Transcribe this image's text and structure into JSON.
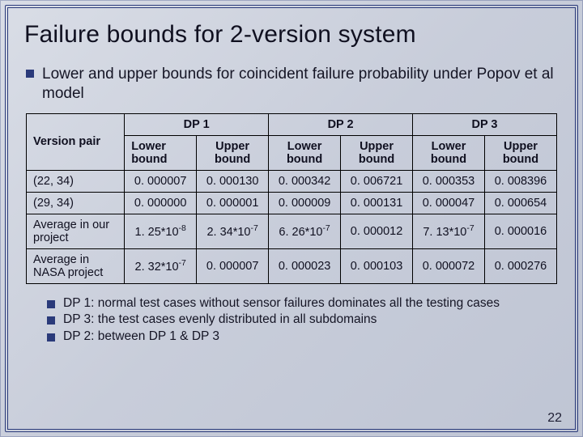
{
  "title": "Failure bounds for 2-version system",
  "lead": "Lower and upper bounds for coincident failure probability under Popov et al model",
  "table": {
    "corner": "Version pair",
    "dp_headers": [
      "DP 1",
      "DP 2",
      "DP 3"
    ],
    "sub_headers": [
      "Lower bound",
      "Upper bound"
    ],
    "rows": [
      {
        "label": "(22, 34)",
        "cells": [
          "0. 000007",
          "0. 000130",
          "0. 000342",
          "0. 006721",
          "0. 000353",
          "0. 008396"
        ]
      },
      {
        "label": "(29, 34)",
        "cells": [
          "0. 000000",
          "0. 000001",
          "0. 000009",
          "0. 000131",
          "0. 000047",
          "0. 000654"
        ]
      },
      {
        "label": "Average in our project",
        "cells": [
          "1. 25*10<sup>-8</sup>",
          "2. 34*10<sup>-7</sup>",
          "6. 26*10<sup>-7</sup>",
          "0. 000012",
          "7. 13*10<sup>-7</sup>",
          "0. 000016"
        ]
      },
      {
        "label": "Average in NASA project",
        "cells": [
          "2. 32*10<sup>-7</sup>",
          "0. 000007",
          "0. 000023",
          "0. 000103",
          "0. 000072",
          "0. 000276"
        ]
      }
    ]
  },
  "notes": [
    "DP 1: normal test cases without sensor failures dominates all the testing cases",
    "DP 3: the test cases evenly distributed in all subdomains",
    "DP 2: between DP 1 & DP 3"
  ],
  "page": "22",
  "chart_data": {
    "type": "table",
    "title": "Failure bounds for 2-version system",
    "columns": [
      "Version pair",
      "DP1 Lower bound",
      "DP1 Upper bound",
      "DP2 Lower bound",
      "DP2 Upper bound",
      "DP3 Lower bound",
      "DP3 Upper bound"
    ],
    "rows": [
      [
        "(22, 34)",
        7e-06,
        0.00013,
        0.000342,
        0.006721,
        0.000353,
        0.008396
      ],
      [
        "(29, 34)",
        0.0,
        1e-06,
        9e-06,
        0.000131,
        4.7e-05,
        0.000654
      ],
      [
        "Average in our project",
        1.25e-08,
        2.34e-07,
        6.26e-07,
        1.2e-05,
        7.13e-07,
        1.6e-05
      ],
      [
        "Average in NASA project",
        2.32e-07,
        7e-06,
        2.3e-05,
        0.000103,
        7.2e-05,
        0.000276
      ]
    ]
  }
}
